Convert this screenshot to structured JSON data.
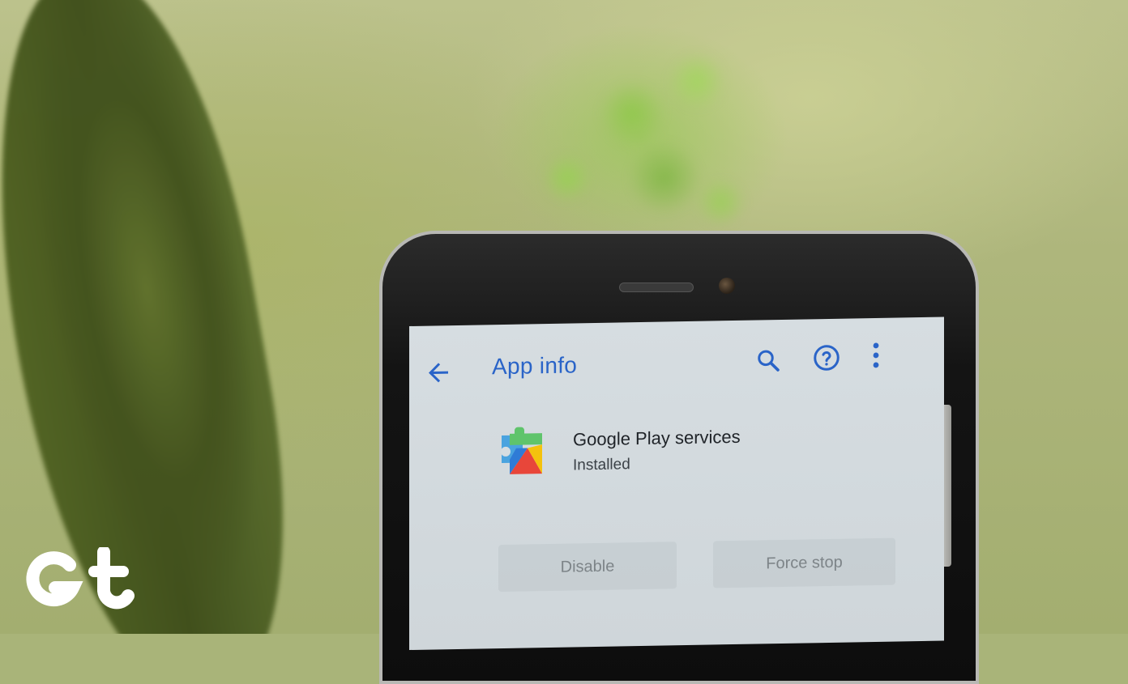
{
  "app_info": {
    "title": "App info"
  },
  "app": {
    "name": "Google Play services",
    "status": "Installed"
  },
  "actions": {
    "disable_label": "Disable",
    "force_stop_label": "Force stop"
  },
  "icons": {
    "back": "arrow-back-icon",
    "search": "search-icon",
    "help": "help-circle-icon",
    "more": "more-vert-icon",
    "app": "google-play-services-icon",
    "watermark": "gt-logo"
  },
  "colors": {
    "accent": "#2a64c8",
    "screen_bg": "#d6dde1"
  }
}
